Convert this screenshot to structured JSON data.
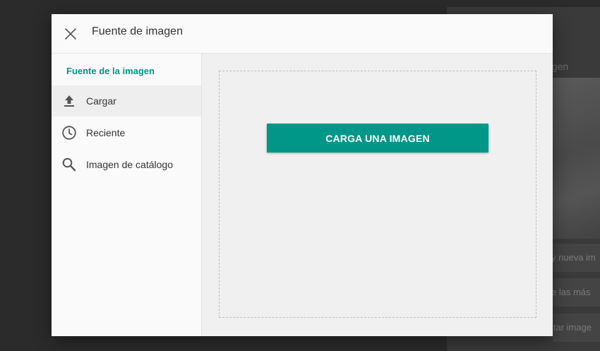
{
  "background": {
    "title_fragment": "agen",
    "rows": [
      "y nueva im",
      "e las más",
      "itar image"
    ]
  },
  "dialog": {
    "title": "Fuente de imagen",
    "close_icon": "close-icon"
  },
  "sidebar": {
    "heading": "Fuente de la imagen",
    "items": [
      {
        "label": "Cargar",
        "icon": "upload-icon",
        "active": true
      },
      {
        "label": "Reciente",
        "icon": "clock-icon",
        "active": false
      },
      {
        "label": "Imagen de catálogo",
        "icon": "search-icon",
        "active": false
      }
    ]
  },
  "main": {
    "upload_button_label": "CARGA UNA IMAGEN"
  },
  "colors": {
    "accent": "#009688",
    "overlay": "#2b2b2b",
    "active_item_bg": "#eeeeee"
  }
}
